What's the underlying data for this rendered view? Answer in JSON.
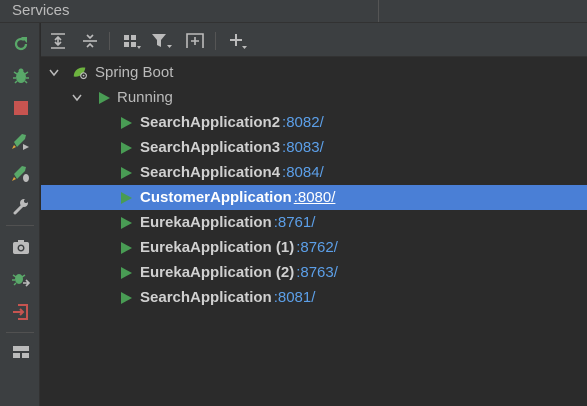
{
  "window": {
    "title": "Services"
  },
  "tree": {
    "root": {
      "label": "Spring Boot",
      "expanded": true
    },
    "group": {
      "label": "Running",
      "expanded": true
    },
    "apps": [
      {
        "name": "SearchApplication2",
        "port": ":8082/",
        "selected": false
      },
      {
        "name": "SearchApplication3",
        "port": ":8083/",
        "selected": false
      },
      {
        "name": "SearchApplication4",
        "port": ":8084/",
        "selected": false
      },
      {
        "name": "CustomerApplication",
        "port": ":8080/",
        "selected": true
      },
      {
        "name": "EurekaApplication",
        "port": ":8761/",
        "selected": false
      },
      {
        "name": "EurekaApplication (1)",
        "port": ":8762/",
        "selected": false
      },
      {
        "name": "EurekaApplication (2)",
        "port": ":8763/",
        "selected": false
      },
      {
        "name": "SearchApplication",
        "port": ":8081/",
        "selected": false
      }
    ]
  },
  "sidebar_icons": [
    "rerun-icon",
    "debug-icon",
    "stop-icon",
    "run-config-icon",
    "coverage-icon",
    "settings-wrench-icon",
    "camera-icon",
    "debug-export-icon",
    "login-icon",
    "layout-icon"
  ],
  "toolbar_icons": [
    "expand-all-icon",
    "collapse-all-icon",
    "group-by-icon",
    "filter-icon",
    "new-tab-icon",
    "add-icon"
  ],
  "colors": {
    "accent": "#4a7fd6",
    "run": "#499c54",
    "stop": "#c75450",
    "port": "#5c9fe8"
  }
}
